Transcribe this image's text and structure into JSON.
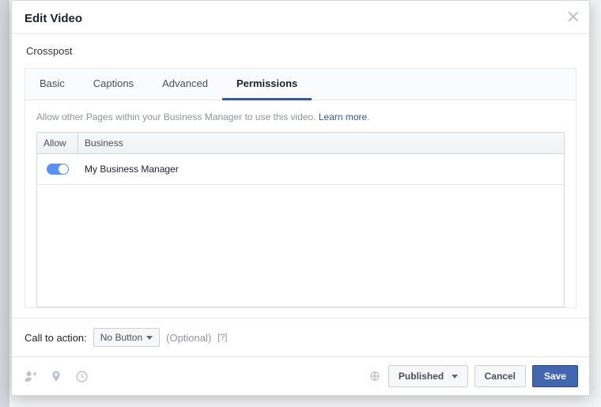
{
  "modal": {
    "title": "Edit Video",
    "section": "Crosspost"
  },
  "tabs": [
    {
      "label": "Basic",
      "active": false
    },
    {
      "label": "Captions",
      "active": false
    },
    {
      "label": "Advanced",
      "active": false
    },
    {
      "label": "Permissions",
      "active": true
    }
  ],
  "permissions": {
    "hint_text": "Allow other Pages within your Business Manager to use this video. ",
    "learn_more": "Learn more",
    "columns": {
      "allow": "Allow",
      "business": "Business"
    },
    "rows": [
      {
        "allowed": true,
        "business": "My Business Manager"
      }
    ]
  },
  "cta": {
    "label": "Call to action:",
    "selected": "No Button",
    "optional": "(Optional)",
    "help": "[?]"
  },
  "footer": {
    "published_label": "Published",
    "cancel": "Cancel",
    "save": "Save"
  }
}
